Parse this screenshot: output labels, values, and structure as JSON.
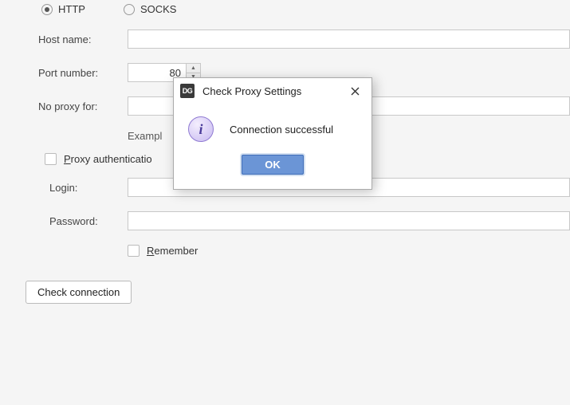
{
  "proxy": {
    "type_http": "HTTP",
    "type_socks": "SOCKS",
    "host_label": "Host name:",
    "host_value": "",
    "port_label": "Port number:",
    "port_value": "80",
    "noproxy_label": "No proxy for:",
    "noproxy_value": "",
    "example_label": "Exampl",
    "auth_label": "Proxy authenticatio",
    "login_label": "Login:",
    "login_value": "",
    "password_label": "Password:",
    "password_value": "",
    "remember_label": "Remember",
    "check_btn": "Check connection"
  },
  "dialog": {
    "app_icon_text": "DG",
    "title": "Check Proxy Settings",
    "message": "Connection successful",
    "ok": "OK"
  }
}
